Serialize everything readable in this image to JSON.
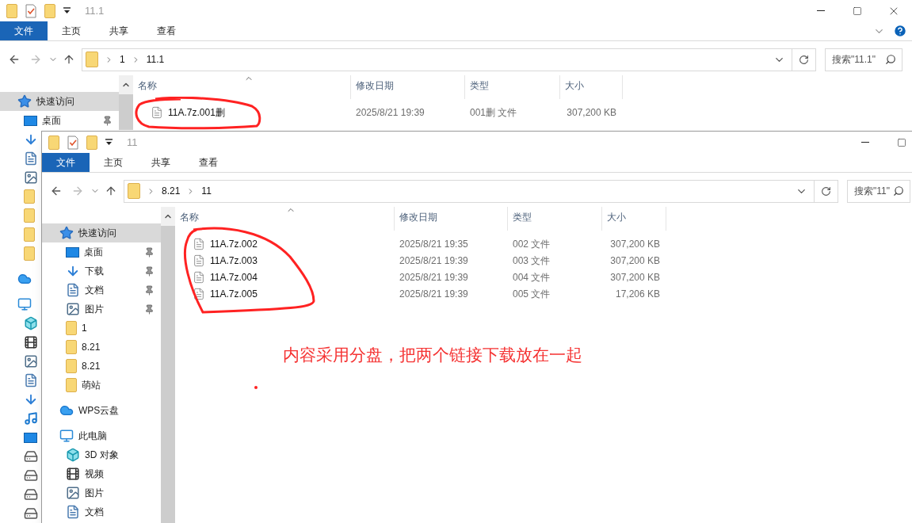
{
  "back_window": {
    "title": "11.1",
    "ribbon_tabs": [
      {
        "label": "文件",
        "selected": true
      },
      {
        "label": "主页",
        "selected": false
      },
      {
        "label": "共享",
        "selected": false
      },
      {
        "label": "查看",
        "selected": false
      }
    ],
    "breadcrumb": [
      "1",
      "11.1"
    ],
    "search": {
      "placeholder": "搜索\"11.1\""
    },
    "nav": [
      {
        "label": "快速访问",
        "kind": "star",
        "selected": true,
        "children": [
          {
            "label": "桌面",
            "kind": "desktop",
            "pinned": true
          },
          {
            "kind": "download"
          },
          {
            "kind": "document"
          },
          {
            "kind": "picture"
          },
          {
            "kind": "folder"
          },
          {
            "kind": "folder"
          },
          {
            "kind": "folder"
          },
          {
            "kind": "folder"
          }
        ]
      },
      {
        "kind": "cloud",
        "selected": false
      },
      {
        "kind": "computer",
        "selected": false,
        "children": [
          {
            "kind": "cube"
          },
          {
            "kind": "video"
          },
          {
            "kind": "picture"
          },
          {
            "kind": "document"
          },
          {
            "kind": "download"
          },
          {
            "kind": "music"
          },
          {
            "kind": "desktop"
          },
          {
            "kind": "drive"
          },
          {
            "kind": "drive"
          },
          {
            "kind": "drive"
          },
          {
            "kind": "drive"
          }
        ]
      }
    ],
    "columns": [
      "名称",
      "修改日期",
      "类型",
      "大小"
    ],
    "rows": [
      {
        "name": "11A.7z.001删",
        "date": "2025/8/21 19:39",
        "type": "001删 文件",
        "size": "307,200 KB"
      }
    ]
  },
  "front_window": {
    "title": "11",
    "ribbon_tabs": [
      {
        "label": "文件",
        "selected": true
      },
      {
        "label": "主页",
        "selected": false
      },
      {
        "label": "共享",
        "selected": false
      },
      {
        "label": "查看",
        "selected": false
      }
    ],
    "breadcrumb": [
      "8.21",
      "11"
    ],
    "search": {
      "placeholder": "搜索\"11\""
    },
    "nav": [
      {
        "label": "快速访问",
        "kind": "star",
        "selected": true,
        "children": [
          {
            "label": "桌面",
            "kind": "desktop",
            "pinned": true
          },
          {
            "label": "下载",
            "kind": "download",
            "pinned": true
          },
          {
            "label": "文档",
            "kind": "document",
            "pinned": true
          },
          {
            "label": "图片",
            "kind": "picture",
            "pinned": true
          },
          {
            "label": "1",
            "kind": "folder",
            "pinned": false
          },
          {
            "label": "8.21",
            "kind": "folder",
            "pinned": false
          },
          {
            "label": "8.21",
            "kind": "folder",
            "pinned": false
          },
          {
            "label": "萌站",
            "kind": "folder",
            "pinned": false
          }
        ]
      },
      {
        "label": "WPS云盘",
        "kind": "cloud",
        "selected": false
      },
      {
        "label": "此电脑",
        "kind": "computer",
        "selected": false,
        "children": [
          {
            "label": "3D 对象",
            "kind": "cube"
          },
          {
            "label": "视频",
            "kind": "video"
          },
          {
            "label": "图片",
            "kind": "picture"
          },
          {
            "label": "文档",
            "kind": "document"
          }
        ]
      }
    ],
    "columns": [
      "名称",
      "修改日期",
      "类型",
      "大小"
    ],
    "rows": [
      {
        "name": "11A.7z.002",
        "date": "2025/8/21 19:35",
        "type": "002 文件",
        "size": "307,200 KB"
      },
      {
        "name": "11A.7z.003",
        "date": "2025/8/21 19:39",
        "type": "003 文件",
        "size": "307,200 KB"
      },
      {
        "name": "11A.7z.004",
        "date": "2025/8/21 19:39",
        "type": "004 文件",
        "size": "307,200 KB"
      },
      {
        "name": "11A.7z.005",
        "date": "2025/8/21 19:39",
        "type": "005 文件",
        "size": "17,206 KB"
      }
    ]
  },
  "annotation": "内容采用分盘，把两个链接下载放在一起"
}
